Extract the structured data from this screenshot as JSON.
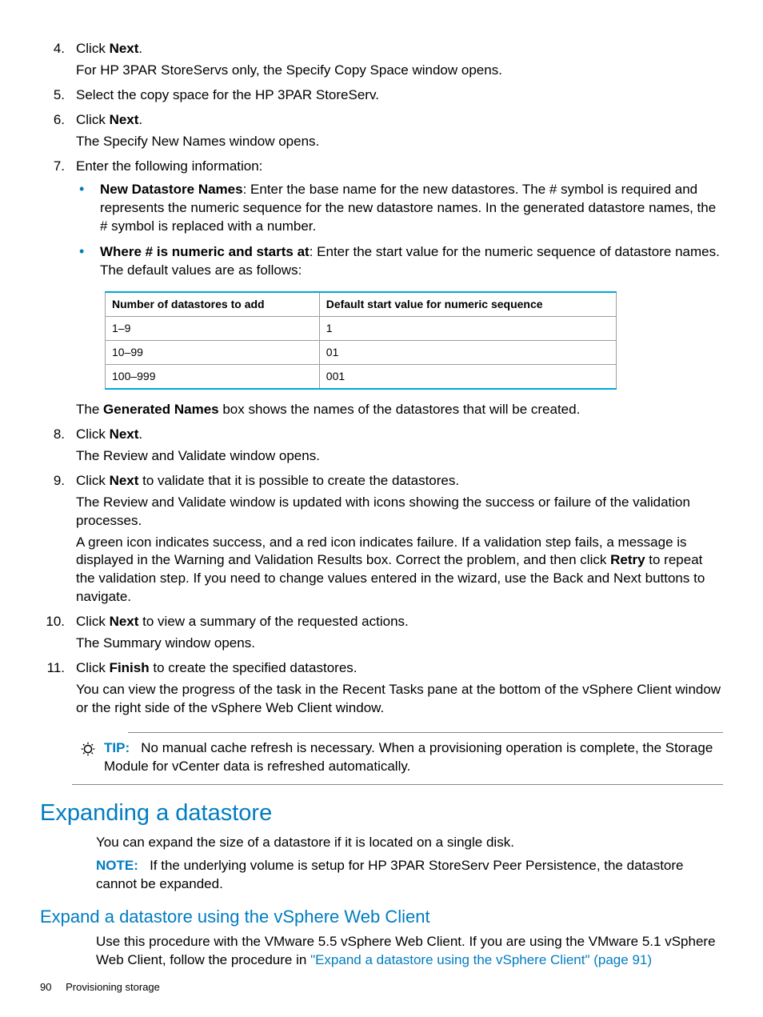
{
  "steps": {
    "s4": {
      "num": "4.",
      "l1a": "Click ",
      "l1b": "Next",
      "l1c": ".",
      "l2": "For HP 3PAR StoreServs only, the Specify Copy Space window opens."
    },
    "s5": {
      "num": "5.",
      "l1": "Select the copy space for the HP 3PAR StoreServ."
    },
    "s6": {
      "num": "6.",
      "l1a": "Click ",
      "l1b": "Next",
      "l1c": ".",
      "l2": "The Specify New Names window opens."
    },
    "s7": {
      "num": "7.",
      "l1": "Enter the following information:",
      "b1": {
        "lead": "New Datastore Names",
        "rest": ": Enter the base name for the new datastores. The # symbol is required and represents the numeric sequence for the new datastore names. In the generated datastore names, the # symbol is replaced with a number."
      },
      "b2": {
        "lead": "Where # is numeric and starts at",
        "rest": ": Enter the start value for the numeric sequence of datastore names. The default values are as follows:"
      },
      "table": {
        "h1": "Number of datastores to add",
        "h2": "Default start value for numeric sequence",
        "rows": [
          {
            "c1": "1–9",
            "c2": "1"
          },
          {
            "c1": "10–99",
            "c2": "01"
          },
          {
            "c1": "100–999",
            "c2": "001"
          }
        ]
      },
      "after_a": "The ",
      "after_b": "Generated Names",
      "after_c": " box shows the names of the datastores that will be created."
    },
    "s8": {
      "num": "8.",
      "l1a": "Click ",
      "l1b": "Next",
      "l1c": ".",
      "l2": "The Review and Validate window opens."
    },
    "s9": {
      "num": "9.",
      "l1a": "Click ",
      "l1b": "Next",
      "l1c": " to validate that it is possible to create the datastores.",
      "l2": "The Review and Validate window is updated with icons showing the success or failure of the validation processes.",
      "l3a": "A green icon indicates success, and a red icon indicates failure. If a validation step fails, a message is displayed in the Warning and Validation Results box. Correct the problem, and then click ",
      "l3b": "Retry",
      "l3c": " to repeat the validation step. If you need to change values entered in the wizard, use the Back and Next buttons to navigate."
    },
    "s10": {
      "num": "10.",
      "l1a": "Click ",
      "l1b": "Next",
      "l1c": " to view a summary of the requested actions.",
      "l2": "The Summary window opens."
    },
    "s11": {
      "num": "11.",
      "l1a": "Click ",
      "l1b": "Finish",
      "l1c": " to create the specified datastores.",
      "l2": "You can view the progress of the task in the Recent Tasks pane at the bottom of the vSphere Client window or the right side of the vSphere Web Client window."
    }
  },
  "tip": {
    "label": "TIP:",
    "body": "No manual cache refresh is necessary. When a provisioning operation is complete, the Storage Module for vCenter data is refreshed automatically."
  },
  "expand": {
    "h2": "Expanding a datastore",
    "p1": "You can expand the size of a datastore if it is located on a single disk.",
    "note_label": "NOTE:",
    "note_body": "If the underlying volume is setup for HP 3PAR StoreServ Peer Persistence, the datastore cannot be expanded.",
    "h3": "Expand a datastore using the vSphere Web Client",
    "p2a": "Use this procedure with the VMware 5.5 vSphere Web Client. If you are using the VMware 5.1 vSphere Web Client, follow the procedure in ",
    "p2link": "\"Expand a datastore using the vSphere Client\" (page 91)"
  },
  "footer": {
    "page": "90",
    "title": "Provisioning storage"
  }
}
